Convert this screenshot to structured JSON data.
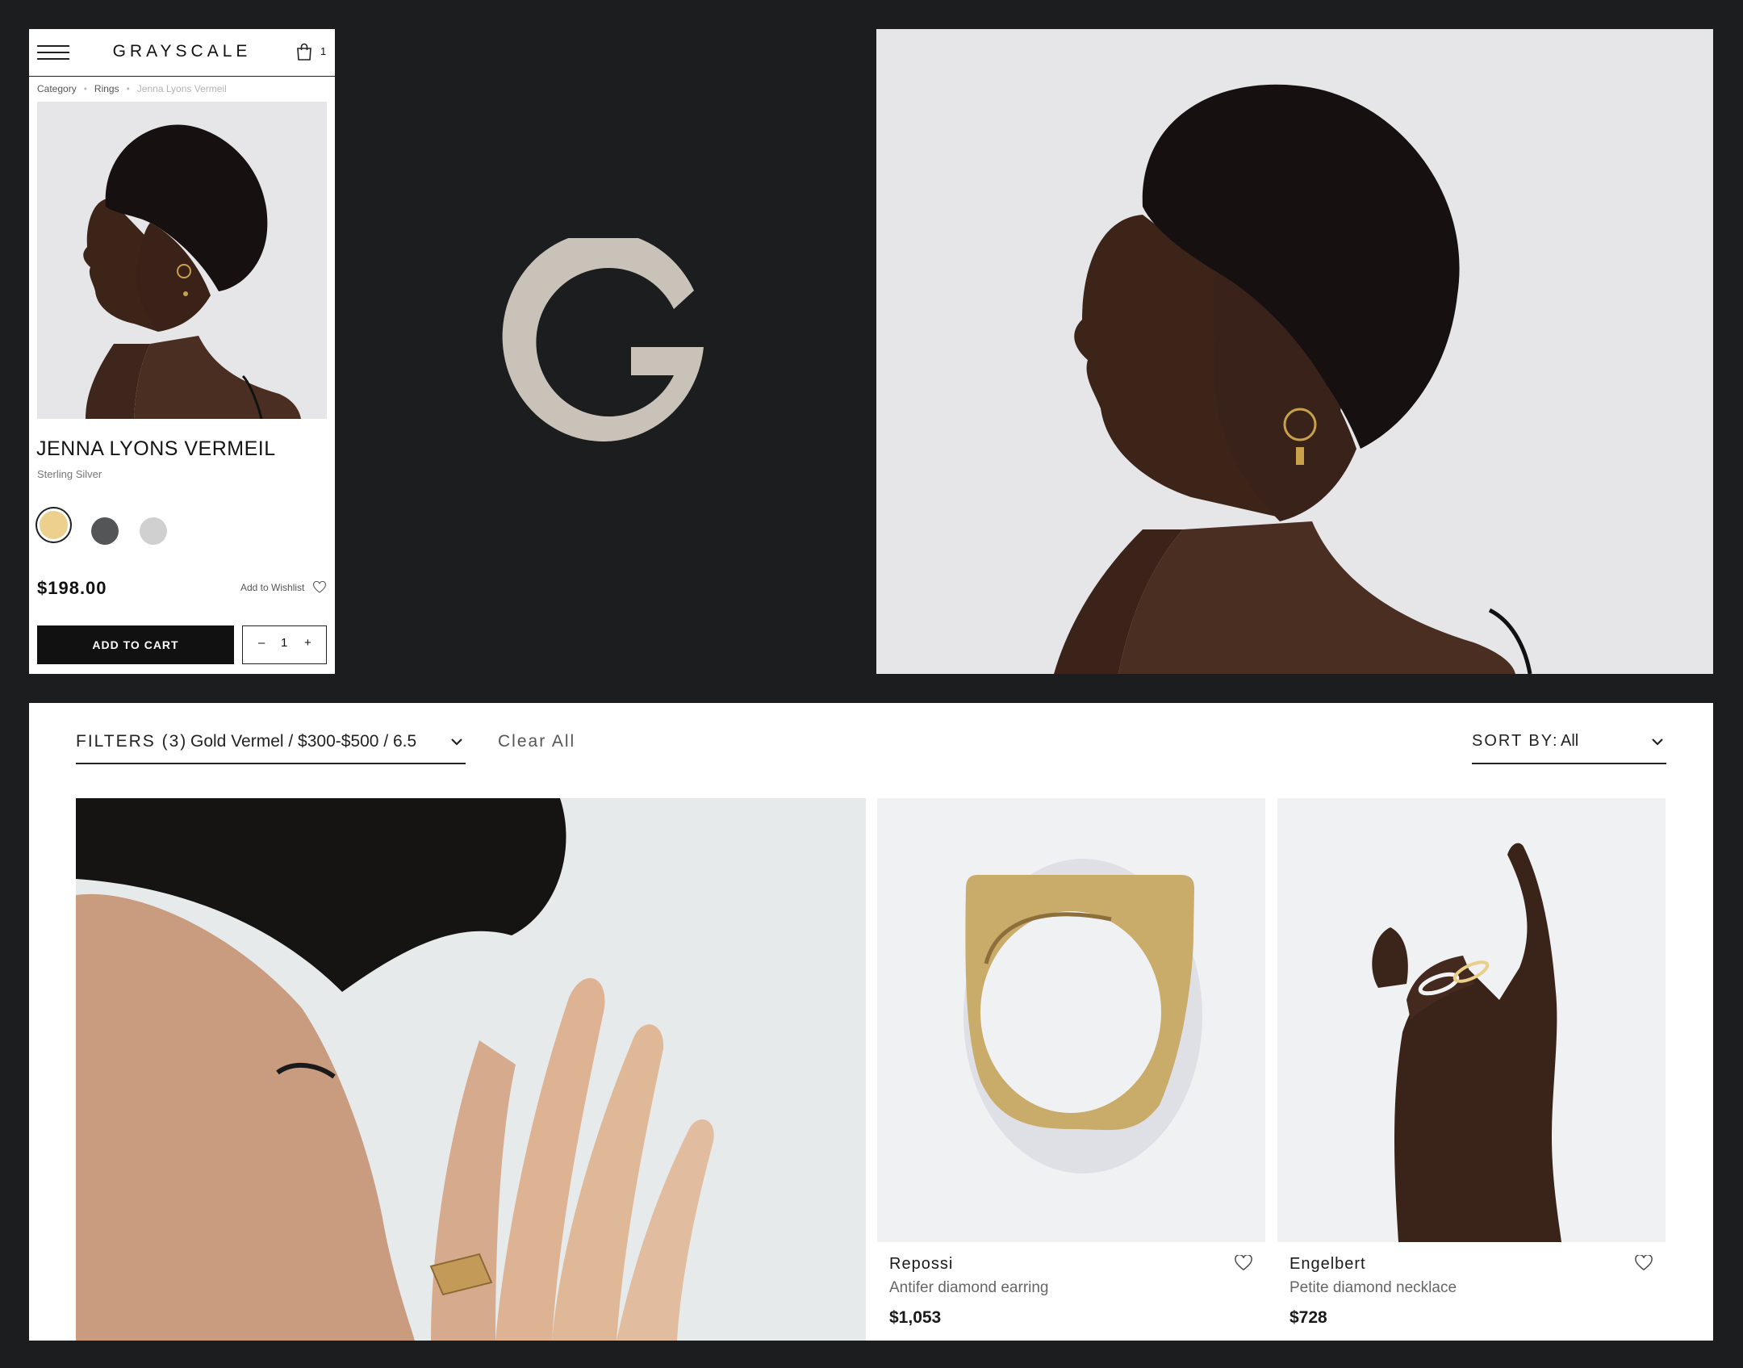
{
  "mobile": {
    "brand": "GRAYSCALE",
    "cart_count": "1",
    "breadcrumb": [
      "Category",
      "Rings",
      "Jenna Lyons Vermeil"
    ],
    "product": {
      "title": "JENNA LYONS VERMEIL",
      "material": "Sterling Silver",
      "swatch_colors": [
        "#edcf8e",
        "#545556",
        "#d0d0d0"
      ],
      "price": "$198.00",
      "wishlist_label": "Add to Wishlist",
      "add_to_cart_label": "ADD TO CART",
      "quantity": "1",
      "qty_minus": "–",
      "qty_plus": "+"
    }
  },
  "logo": {
    "letter": "G",
    "color": "#c9c2b8"
  },
  "listing": {
    "filters_label": "FILTERS (3)",
    "filters_value": "Gold Vermel / $300-$500 / 6.5",
    "clear_all": "Clear All",
    "sort_label": "SORT BY:",
    "sort_value": "All",
    "products": [
      {
        "name": "Repossi",
        "description": "Antifer diamond earring",
        "price": "$1,053"
      },
      {
        "name": "Engelbert",
        "description": "Petite diamond necklace",
        "price": "$728"
      }
    ]
  }
}
